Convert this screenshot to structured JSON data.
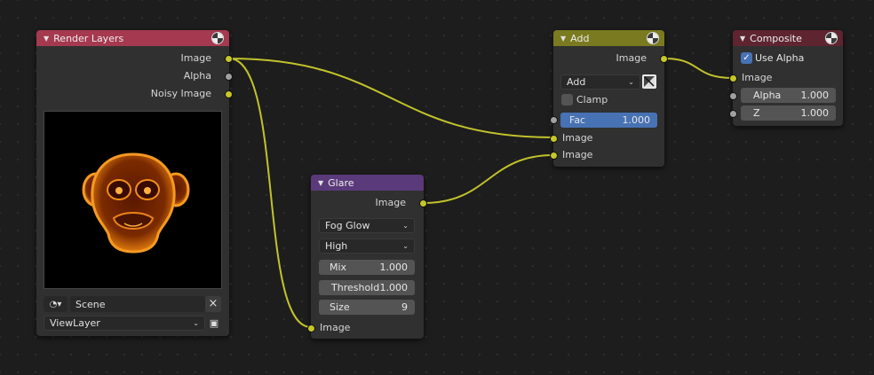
{
  "nodes": {
    "render_layers": {
      "title": "Render Layers",
      "header_color": "#a53950",
      "outputs": [
        "Image",
        "Alpha",
        "Noisy Image"
      ],
      "scene_value": "Scene",
      "view_layer_value": "ViewLayer",
      "clear_icon": "×"
    },
    "glare": {
      "title": "Glare",
      "header_color": "#5a3a7a",
      "output": "Image",
      "glare_type": "Fog Glow",
      "quality": "High",
      "mix": {
        "label": "Mix",
        "value": "1.000"
      },
      "threshold": {
        "label": "Threshold",
        "value": "1.000"
      },
      "size": {
        "label": "Size",
        "value": "9"
      },
      "input": "Image"
    },
    "add": {
      "title": "Add",
      "header_color": "#7a7a20",
      "output": "Image",
      "blend_type": "Add",
      "clamp_label": "Clamp",
      "clamp_checked": false,
      "fac": {
        "label": "Fac",
        "value": "1.000"
      },
      "inputs": [
        "Image",
        "Image"
      ]
    },
    "composite": {
      "title": "Composite",
      "header_color": "#5e2430",
      "use_alpha_label": "Use Alpha",
      "use_alpha_checked": true,
      "input_image": "Image",
      "alpha": {
        "label": "Alpha",
        "value": "1.000"
      },
      "z": {
        "label": "Z",
        "value": "1.000"
      }
    }
  },
  "colors": {
    "socket_color_yellow": "#c7c729",
    "socket_color_grey": "#a1a1a1",
    "wire_color": "#c2c22c",
    "field_active": "#4772b3"
  }
}
